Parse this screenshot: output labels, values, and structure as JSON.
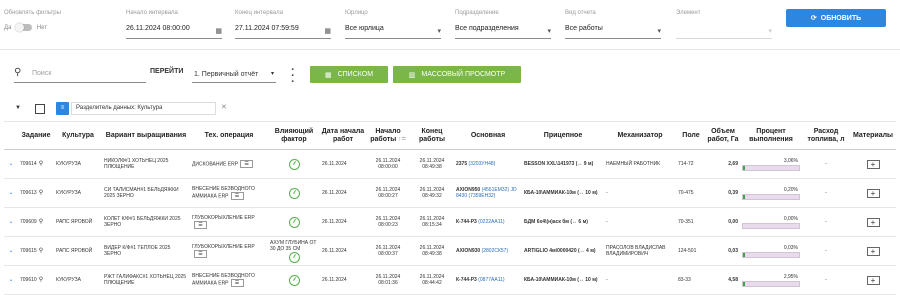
{
  "filters": {
    "refresh_filters_label": "Обновлять фильтры",
    "toggle_yes": "Да",
    "toggle_no": "Нет",
    "start_label": "Начало интервала",
    "start_value": "26.11.2024 08:00:00",
    "end_label": "Конец интервала",
    "end_value": "27.11.2024 07:59:59",
    "entity_label": "Юрлицо",
    "entity_value": "Все юрлица",
    "division_label": "Подразделение",
    "division_value": "Все подразделения",
    "report_type_label": "Вид отчета",
    "report_type_value": "Все работы",
    "element_label": "Элемент",
    "element_value": "",
    "refresh_button": "ОБНОВИТЬ",
    "accent_color": "#2e86de"
  },
  "toolbar": {
    "search_placeholder": "Поиск",
    "go_label": "ПЕРЕЙТИ",
    "report_select": "1. Первичный отчёт",
    "list_button": "СПИСКОМ",
    "mass_view_button": "МАССОВЫЙ ПРОСМОТР",
    "green_color": "#7ab648"
  },
  "grouping": {
    "chip_label": "Разделитель данных: Культура"
  },
  "table": {
    "headers": {
      "task": "Задание",
      "culture": "Культура",
      "variant": "Вариант выращивания",
      "operation": "Тех. операция",
      "factor": "Влияющий фактор",
      "start_date": "Дата начала работ",
      "work_start": "Начало работы",
      "work_end": "Конец работы",
      "main": "Основная",
      "trailer": "Прицепное",
      "operator": "Механизатор",
      "field": "Поле",
      "volume": "Объем работ, Га",
      "percent": "Процент выполнения",
      "fuel": "Расход топлива, л",
      "materials": "Материалы"
    },
    "rows": [
      {
        "task": "709614",
        "culture": "КУКУРУЗА",
        "variant": "НИКОЛФ#1 ХОТЬНЕЦ 2025 ПЛЮЩЕНИЕ",
        "operation": "ДИСКОВАНИЕ ERP",
        "factor_text": "",
        "start_date": "26.11.2024",
        "work_start_date": "26.11.2024",
        "work_start_time": "08:00:00",
        "work_end_date": "26.11.2024",
        "work_end_time": "08:49:38",
        "main_name": "2375",
        "main_code": "(3203УН48)",
        "trailer": "BESSON XXL\\141973 (↔ 9 м)",
        "operator": "НАЕМНЫЙ РАБОТНИК",
        "field": "714-72",
        "volume": "2,69",
        "percent_label": "3,06%",
        "percent_value": 3.06,
        "fuel": "-"
      },
      {
        "task": "709613",
        "culture": "КУКУРУЗА",
        "variant": "СИ ТАЛИСМАН#1 БЕЛЬДЯЖКИ 2025 ЗЕРНО",
        "operation": "ВНЕСЕНИЕ БЕЗВОДНОГО АММИАКА ERP",
        "factor_text": "",
        "start_date": "26.11.2024",
        "work_start_date": "26.11.2024",
        "work_start_time": "08:00:27",
        "work_end_date": "26.11.2024",
        "work_end_time": "08:49:32",
        "main_name": "AXION950",
        "main_code": "(4561ЕМ32)",
        "main_extra": "JD 8430 (7359ЕН32)",
        "trailer": "КБА-10\\АММИАК-10м (↔ 10 м)",
        "operator": "-",
        "field": "70-475",
        "volume": "0,39",
        "percent_label": "0,20%",
        "percent_value": 0.2,
        "fuel": "-"
      },
      {
        "task": "709609",
        "culture": "РАПС ЯРОВОЙ",
        "variant": "КОЛЕТ К/Ф#1 БЕЛЬДЯЖКИ 2025 ЗЕРНО",
        "operation": "ГЛУБОКОРЫХЛЕНИЕ ERP",
        "factor_text": "",
        "start_date": "26.11.2024",
        "work_start_date": "26.11.2024",
        "work_start_time": "08:00:23",
        "work_end_date": "26.11.2024",
        "work_end_time": "08:15:34",
        "main_name": "К-744-Р3",
        "main_code": "(0222АА11)",
        "trailer": "БДМ 6х4\\(н)аск бм (↔ 6 м)",
        "operator": "-",
        "field": "70-351",
        "volume": "0,00",
        "percent_label": "0,00%",
        "percent_value": 0.0,
        "fuel": "-"
      },
      {
        "task": "709615",
        "culture": "РАПС ЯРОВОЙ",
        "variant": "ВИДЕР К/Ф#1 ТЕПЛОЕ 2025 ЗЕРНО",
        "operation": "ГЛУБОКОРЫХЛЕНИЕ ERP",
        "factor_text": "АХУМ ГЛУБИНА ОТ 30 ДО 35 СМ",
        "start_date": "26.11.2024",
        "work_start_date": "26.11.2024",
        "work_start_time": "08:00:37",
        "work_end_date": "26.11.2024",
        "work_end_time": "08:49:38",
        "main_name": "AXION930",
        "main_code": "(2802СК57)",
        "trailer": "ARTIGLIO 4м\\0000420 (↔ 4 м)",
        "operator": "ПРАСОЛОВ ВЛАДИСЛАВ ВЛАДИМИРОВИЧ",
        "field": "124-501",
        "volume": "0,03",
        "percent_label": "0,03%",
        "percent_value": 0.03,
        "fuel": "-"
      },
      {
        "task": "709610",
        "culture": "КУКУРУЗА",
        "variant": "РЖТ ГАЛИФАКС#1 ХОТЬНЕЦ 2025 ПЛЮЩЕНИЕ",
        "operation": "ВНЕСЕНИЕ БЕЗВОДНОГО АММИАКА ERP",
        "factor_text": "",
        "start_date": "26.11.2024",
        "work_start_date": "26.11.2024",
        "work_start_time": "08:01:36",
        "work_end_date": "26.11.2024",
        "work_end_time": "08:44:42",
        "main_name": "К-744-Р3",
        "main_code": "(0877АА11)",
        "trailer": "КБА-10\\АММИАК-10м (↔ 10 м)",
        "operator": "-",
        "field": "83-33",
        "volume": "4,58",
        "percent_label": "2,95%",
        "percent_value": 2.95,
        "fuel": "-"
      }
    ]
  }
}
